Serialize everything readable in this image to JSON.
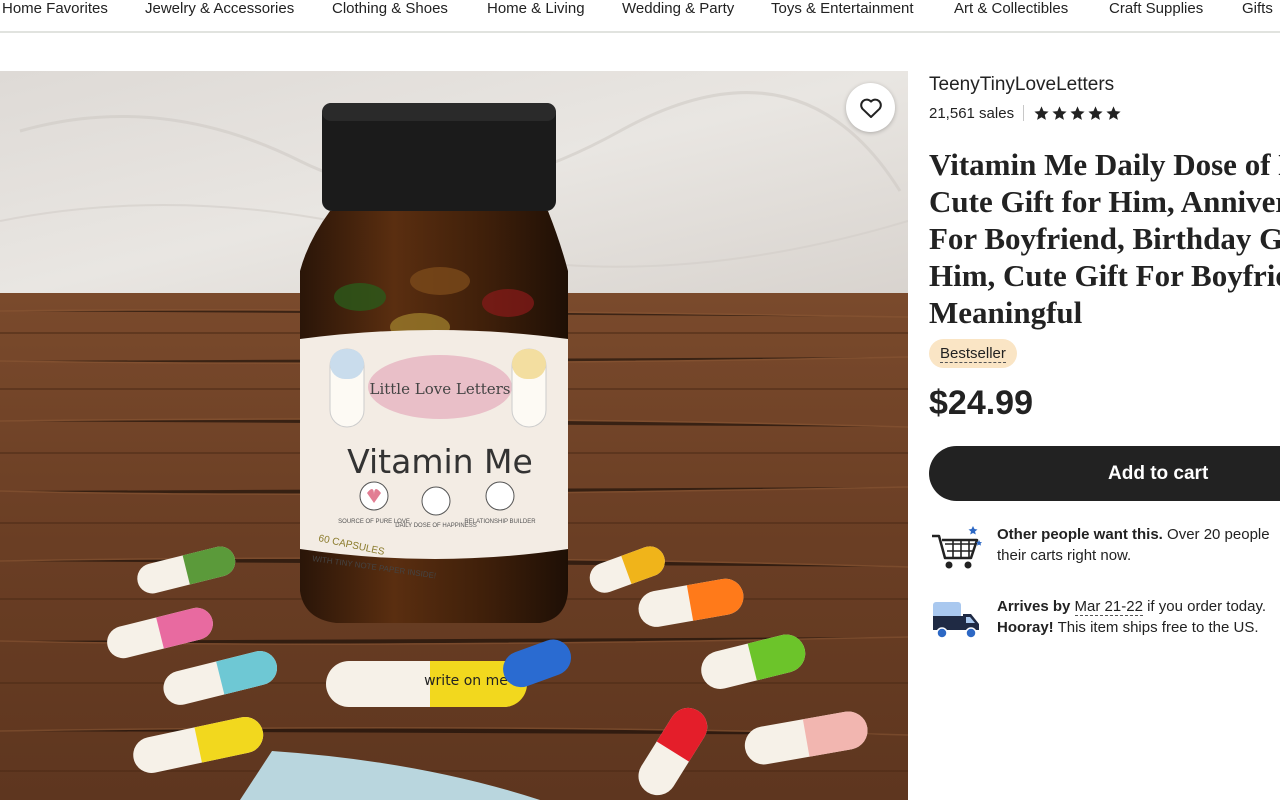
{
  "nav": {
    "categories": [
      "Home Favorites",
      "Jewelry & Accessories",
      "Clothing & Shoes",
      "Home & Living",
      "Wedding & Party",
      "Toys & Entertainment",
      "Art & Collectibles",
      "Craft Supplies",
      "Gifts"
    ]
  },
  "photo": {
    "label_brand": "Little Love Letters",
    "label_product": "Vitamin Me",
    "label_icons": [
      "SOURCE OF PURE LOVE",
      "DAILY DOSE OF HAPPINESS",
      "RELATIONSHIP BUILDER"
    ],
    "label_capsules": "60 CAPSULES",
    "label_note": "WITH TINY NOTE PAPER INSIDE!",
    "pill_note": "write on me"
  },
  "shop": {
    "name": "TeenyTinyLoveLetters",
    "sales": "21,561 sales",
    "rating_stars": 5
  },
  "listing": {
    "title_lines": [
      "Vitamin Me Daily Dose of Love",
      "Cute Gift for Him, Anniversary",
      "For Boyfriend, Birthday Gift",
      "Him, Cute Gift For Boyfriend",
      "Meaningful"
    ],
    "badge": "Bestseller",
    "price": "$24.99",
    "add_to_cart": "Add to cart"
  },
  "notes": {
    "demand_bold": "Other people want this.",
    "demand_rest": " Over 20 people",
    "demand_line2": "their carts right now.",
    "arrives_prefix": "Arrives by ",
    "arrives_date": "Mar 21-22",
    "arrives_suffix": " if you order today.",
    "hooray_bold": "Hooray!",
    "hooray_rest": " This item ships free to the US."
  },
  "colors": {
    "accent_dark": "#222222",
    "badge_bg": "#fae5c5",
    "cart_blue": "#2d68c4"
  },
  "icons": {
    "favorite": "heart-icon",
    "star": "star-icon",
    "cart": "shopping-cart-icon",
    "truck": "delivery-truck-icon"
  }
}
